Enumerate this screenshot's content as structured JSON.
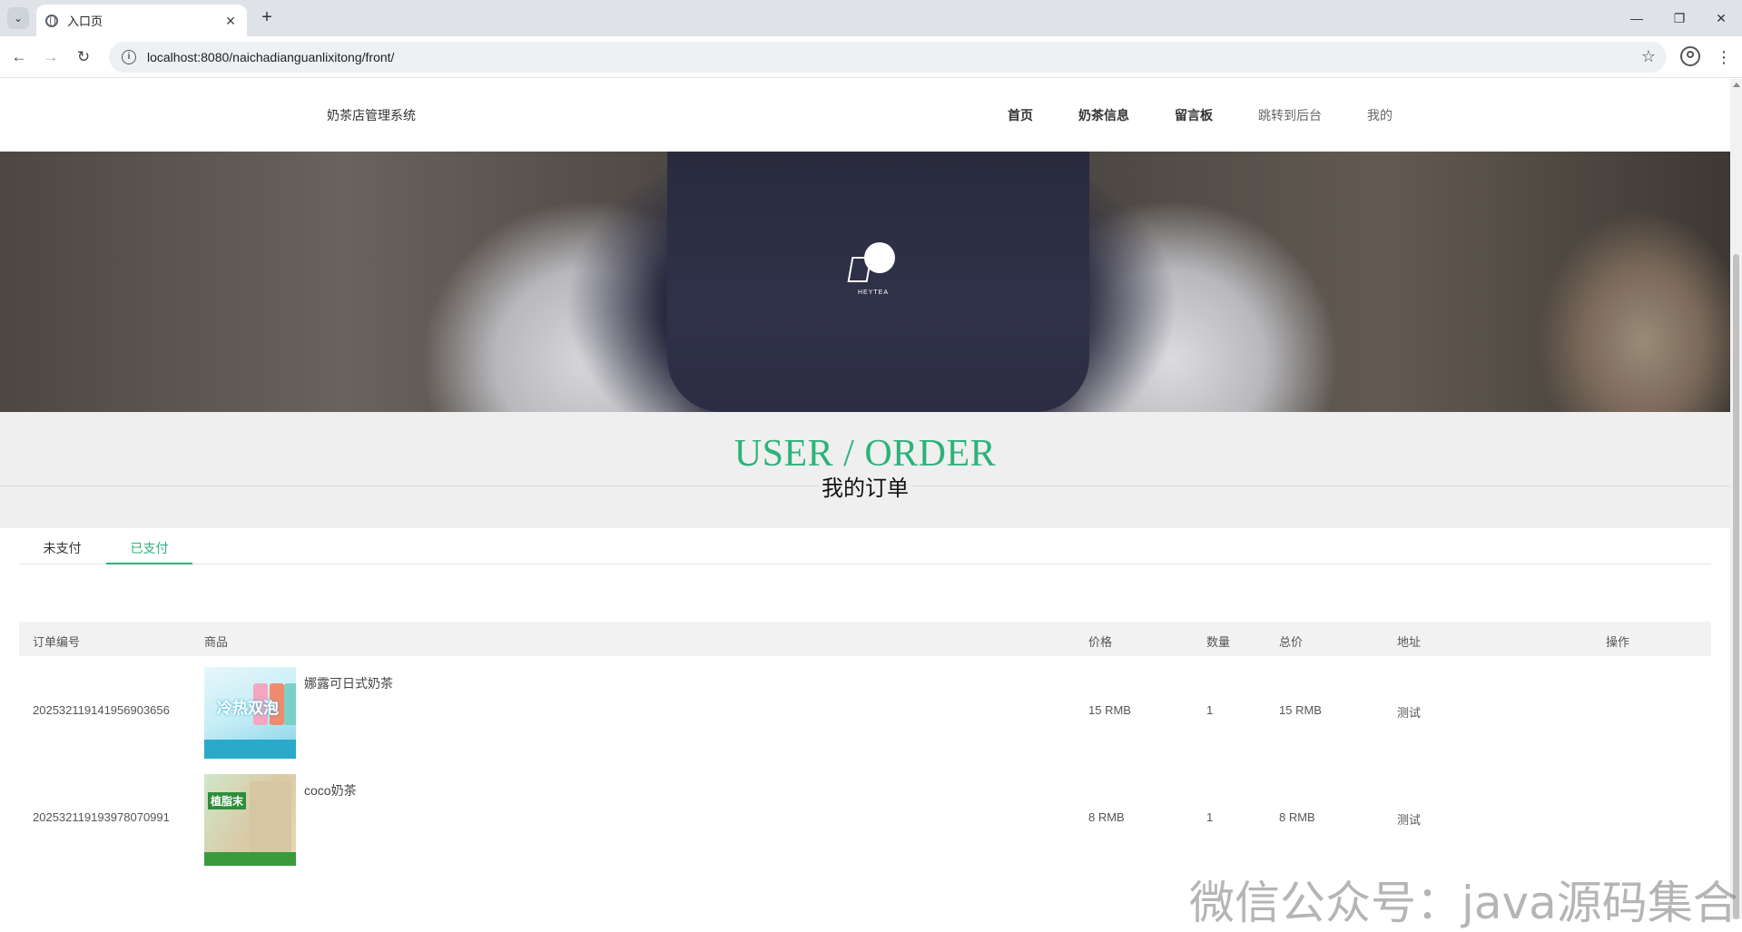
{
  "browser": {
    "tab_title": "入口页",
    "url": "localhost:8080/naichadianguanlixitong/front/",
    "icons": {
      "menu": "chevron-down-icon",
      "close": "close-icon",
      "new_tab": "plus-icon",
      "back": "arrow-left-icon",
      "forward": "arrow-right-icon",
      "reload": "reload-icon",
      "site_info": "info-icon",
      "bookmark": "star-icon",
      "profile": "profile-icon",
      "more": "kebab-icon"
    },
    "glyphs": {
      "menu": "⌄",
      "close": "✕",
      "new_tab": "+",
      "back": "←",
      "forward": "→",
      "reload": "↻",
      "info": "i",
      "star": "☆",
      "more": "⋮",
      "minimize": "—",
      "restore": "❐",
      "window_close": "✕"
    }
  },
  "site": {
    "title": "奶茶店管理系统",
    "nav": [
      "首页",
      "奶茶信息",
      "留言板",
      "跳转到后台",
      "我的"
    ]
  },
  "banner": {
    "logo_text": "HEYTEA"
  },
  "section": {
    "title_en": "USER / ORDER",
    "title_zh": "我的订单"
  },
  "tabs": [
    "未支付",
    "已支付"
  ],
  "active_tab": "已支付",
  "table": {
    "headers": [
      "订单编号",
      "商品",
      "价格",
      "数量",
      "总价",
      "地址",
      "操作"
    ],
    "rows": [
      {
        "order_no": "20253211914195690 3656",
        "goods": "娜露可日式奶茶",
        "price": "15 RMB",
        "qty": "1",
        "total": "15 RMB",
        "address": "测试",
        "image_text": "冷热双泡"
      },
      {
        "order_no": "20253211919397807 0991",
        "goods": "coco奶茶",
        "price": "8 RMB",
        "qty": "1",
        "total": "8 RMB",
        "address": "测试",
        "image_text": "植脂末"
      }
    ]
  },
  "watermark": "微信公众号：java源码集合",
  "colors": {
    "accent": "#2db27a",
    "header_bg": "#efefef"
  }
}
